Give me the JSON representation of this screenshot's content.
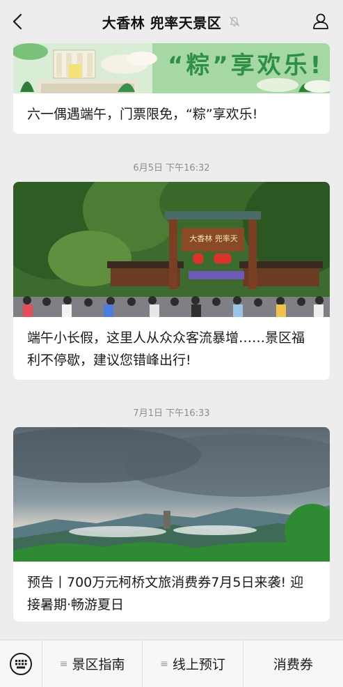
{
  "header": {
    "title": "大香林 兜率天景区",
    "back_icon": "chevron-left-icon",
    "mute_icon": "bell-off-icon",
    "profile_icon": "person-icon"
  },
  "feed": {
    "card1": {
      "banner_text": "“粽”享欢乐!",
      "title": "六一偶遇端午，门票限免，“粽”享欢乐!"
    },
    "timestamp2": "6月5日 下午16:32",
    "card2": {
      "gate_sign": "大香林 兜率天",
      "title": "端午小长假，这里人从众众客流暴增……景区福利不停歇，建议您错峰出行!"
    },
    "timestamp3": "7月1日 下午16:33",
    "card3": {
      "title": "预告丨700万元柯桥文旅消费券7月5日来袭! 迎接暑期·畅游夏日"
    }
  },
  "bottom_bar": {
    "keyboard_icon": "keyboard-icon",
    "menu_glyph": "≡",
    "items": [
      {
        "label": "景区指南",
        "has_submenu": true
      },
      {
        "label": "线上预订",
        "has_submenu": true
      },
      {
        "label": "消费券",
        "has_submenu": false
      }
    ]
  },
  "colors": {
    "background": "#ededed",
    "card": "#ffffff",
    "banner_green": "#2f8f44"
  }
}
